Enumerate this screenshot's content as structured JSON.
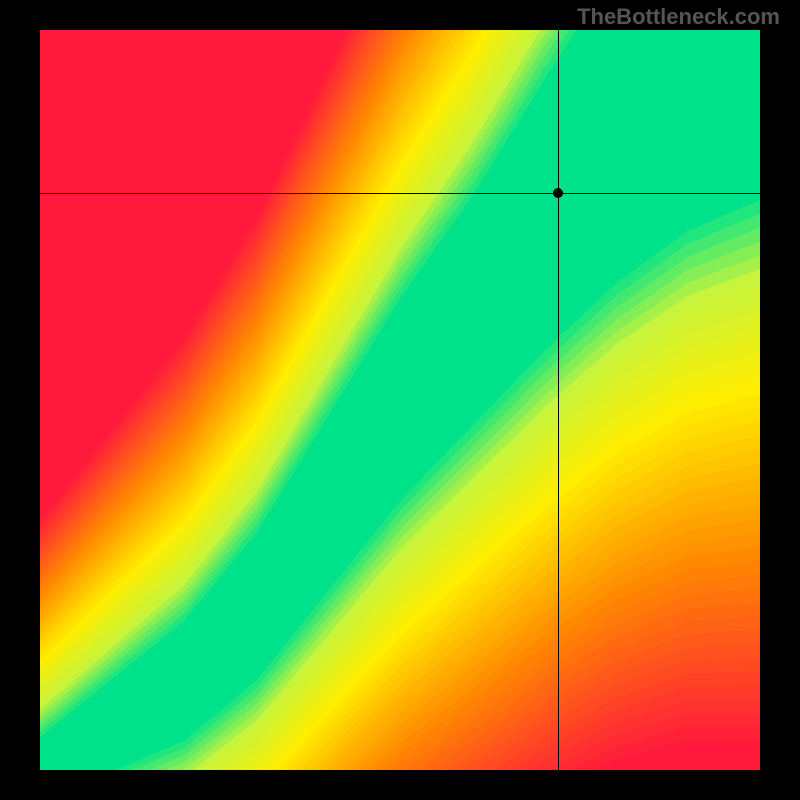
{
  "watermark": "TheBottleneck.com",
  "chart_data": {
    "type": "heatmap",
    "title": "",
    "xlabel": "",
    "ylabel": "",
    "xlim": [
      0,
      100
    ],
    "ylim": [
      0,
      100
    ],
    "grid": false,
    "legend": false,
    "crosshair": {
      "x": 72,
      "y": 78
    },
    "marker": {
      "x": 72,
      "y": 78
    },
    "optimal_ridge": {
      "description": "Green band of optimal match running from lower-left to upper-right; narrow near origin, widening toward top.",
      "points": [
        {
          "x": 0,
          "y": 0
        },
        {
          "x": 10,
          "y": 6
        },
        {
          "x": 20,
          "y": 12
        },
        {
          "x": 30,
          "y": 22
        },
        {
          "x": 40,
          "y": 36
        },
        {
          "x": 50,
          "y": 50
        },
        {
          "x": 60,
          "y": 62
        },
        {
          "x": 70,
          "y": 74
        },
        {
          "x": 80,
          "y": 85
        },
        {
          "x": 90,
          "y": 94
        },
        {
          "x": 100,
          "y": 100
        }
      ]
    },
    "color_scale": {
      "low": "#ff1a3c",
      "mid_low": "#ff8a00",
      "mid": "#ffee00",
      "mid_high": "#c8f53c",
      "high": "#00e28a"
    },
    "corner_values": {
      "bottom_left": "green",
      "top_left": "red",
      "bottom_right": "red",
      "top_right": "yellow"
    }
  }
}
